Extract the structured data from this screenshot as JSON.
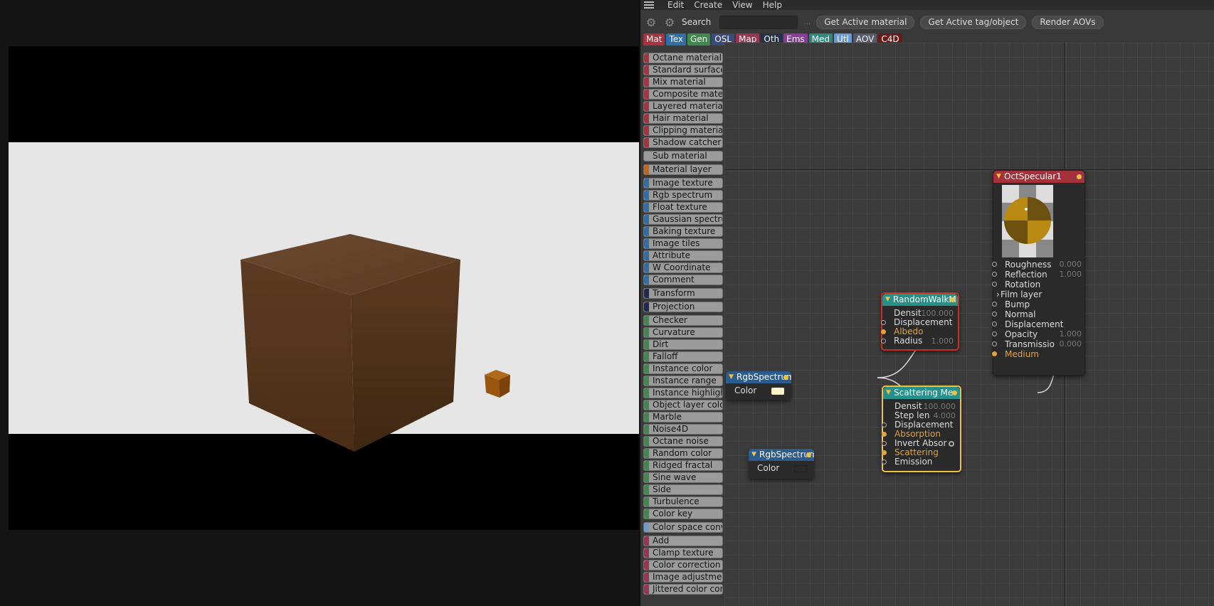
{
  "menu": {
    "items": [
      "Edit",
      "Create",
      "View",
      "Help"
    ]
  },
  "toolbar": {
    "search_label": "Search",
    "buttons": [
      "Get Active material",
      "Get Active tag/object",
      "Render AOVs"
    ]
  },
  "categories": [
    {
      "label": "Mat",
      "color": "#a8323e"
    },
    {
      "label": "Tex",
      "color": "#2f6fa8"
    },
    {
      "label": "Gen",
      "color": "#3e8a4a"
    },
    {
      "label": "OSL",
      "color": "#3a4a7a"
    },
    {
      "label": "Map",
      "color": "#9a3550"
    },
    {
      "label": "Oth",
      "color": "#25304a"
    },
    {
      "label": "Ems",
      "color": "#8a3a9a"
    },
    {
      "label": "Med",
      "color": "#2a8a7a"
    },
    {
      "label": "Utl",
      "color": "#6a9ad0"
    },
    {
      "label": "AOV",
      "color": "#555a66"
    },
    {
      "label": "C4D",
      "color": "#6a1a1a"
    }
  ],
  "node_list": [
    {
      "label": "Octane material",
      "color": "#a8323e"
    },
    {
      "label": "Standard surface",
      "color": "#a8323e"
    },
    {
      "label": "Mix material",
      "color": "#a8323e"
    },
    {
      "label": "Composite material",
      "color": "#a8323e"
    },
    {
      "label": "Layered material",
      "color": "#a8323e"
    },
    {
      "label": "Hair material",
      "color": "#a8323e"
    },
    {
      "label": "Clipping material",
      "color": "#a8323e"
    },
    {
      "label": "Shadow catcher m",
      "color": "#a8323e"
    },
    {
      "label": "Sub material",
      "color": "",
      "gap": true
    },
    {
      "label": "Material layer",
      "color": "#c8641e",
      "gap": true
    },
    {
      "label": "Image texture",
      "color": "#2f6fa8",
      "gap": true
    },
    {
      "label": "Rgb spectrum",
      "color": "#2f6fa8"
    },
    {
      "label": "Float texture",
      "color": "#2f6fa8"
    },
    {
      "label": "Gaussian spectrum",
      "color": "#2f6fa8"
    },
    {
      "label": "Baking texture",
      "color": "#2f6fa8"
    },
    {
      "label": "Image tiles",
      "color": "#2f6fa8"
    },
    {
      "label": "Attribute",
      "color": "#2f6fa8"
    },
    {
      "label": "W Coordinate",
      "color": "#2f6fa8"
    },
    {
      "label": "Comment",
      "color": "#2f6fa8"
    },
    {
      "label": "Transform",
      "color": "#1e2a55",
      "gap": true
    },
    {
      "label": "Projection",
      "color": "#1e2a55",
      "gap": true
    },
    {
      "label": "Checker",
      "color": "#3e8a4a",
      "gap": true
    },
    {
      "label": "Curvature",
      "color": "#3e8a4a"
    },
    {
      "label": "Dirt",
      "color": "#3e8a4a"
    },
    {
      "label": "Falloff",
      "color": "#3e8a4a"
    },
    {
      "label": "Instance color",
      "color": "#3e8a4a"
    },
    {
      "label": "Instance range",
      "color": "#3e8a4a"
    },
    {
      "label": "Instance highlight",
      "color": "#3e8a4a"
    },
    {
      "label": "Object layer color",
      "color": "#3e8a4a"
    },
    {
      "label": "Marble",
      "color": "#3e8a4a"
    },
    {
      "label": "Noise4D",
      "color": "#3e8a4a"
    },
    {
      "label": "Octane noise",
      "color": "#3e8a4a"
    },
    {
      "label": "Random color",
      "color": "#3e8a4a"
    },
    {
      "label": "Ridged fractal",
      "color": "#3e8a4a"
    },
    {
      "label": "Sine wave",
      "color": "#3e8a4a"
    },
    {
      "label": "Side",
      "color": "#3e8a4a"
    },
    {
      "label": "Turbulence",
      "color": "#3e8a4a"
    },
    {
      "label": "Color key",
      "color": "#3e8a4a"
    },
    {
      "label": "Color space conve",
      "color": "#6a9ad0",
      "gap": true
    },
    {
      "label": "Add",
      "color": "#9a3550",
      "gap": true
    },
    {
      "label": "Clamp texture",
      "color": "#9a3550"
    },
    {
      "label": "Color correction",
      "color": "#9a3550"
    },
    {
      "label": "Image adjustment",
      "color": "#9a3550"
    },
    {
      "label": "Jittered color corre",
      "color": "#9a3550"
    }
  ],
  "nodes": {
    "spec": {
      "title": "OctSpecular1",
      "pins": [
        {
          "label": "Roughness",
          "value": "0.000"
        },
        {
          "label": "Reflection",
          "value": "1.000"
        },
        {
          "label": "Rotation",
          "value": ""
        },
        {
          "label": "Film layer",
          "value": ""
        },
        {
          "label": "Bump",
          "value": ""
        },
        {
          "label": "Normal",
          "value": ""
        },
        {
          "label": "Displacement",
          "value": ""
        },
        {
          "label": "Opacity",
          "value": "1.000"
        },
        {
          "label": "Transmissio",
          "value": "0.000"
        },
        {
          "label": "Medium",
          "value": ""
        }
      ]
    },
    "rw": {
      "title": "RandomWalkM",
      "pins": [
        {
          "label": "Densit",
          "value": "100.000"
        },
        {
          "label": "Displacement",
          "value": ""
        },
        {
          "label": "Albedo",
          "value": ""
        },
        {
          "label": "Radius",
          "value": "1.000"
        }
      ]
    },
    "scat": {
      "title": "Scattering Me",
      "pins": [
        {
          "label": "Densit",
          "value": "100.000"
        },
        {
          "label": "Step len",
          "value": "4.000"
        },
        {
          "label": "Displacement",
          "value": ""
        },
        {
          "label": "Absorption",
          "value": ""
        },
        {
          "label": "Invert Absor",
          "value": ""
        },
        {
          "label": "Scattering",
          "value": ""
        },
        {
          "label": "Emission",
          "value": ""
        }
      ]
    },
    "rgb1": {
      "title": "RgbSpectrum",
      "color_label": "Color",
      "swatch": "#fff3cc"
    },
    "rgb2": {
      "title": "RgbSpectrum",
      "color_label": "Color",
      "swatch": "#2a2a2a"
    }
  }
}
